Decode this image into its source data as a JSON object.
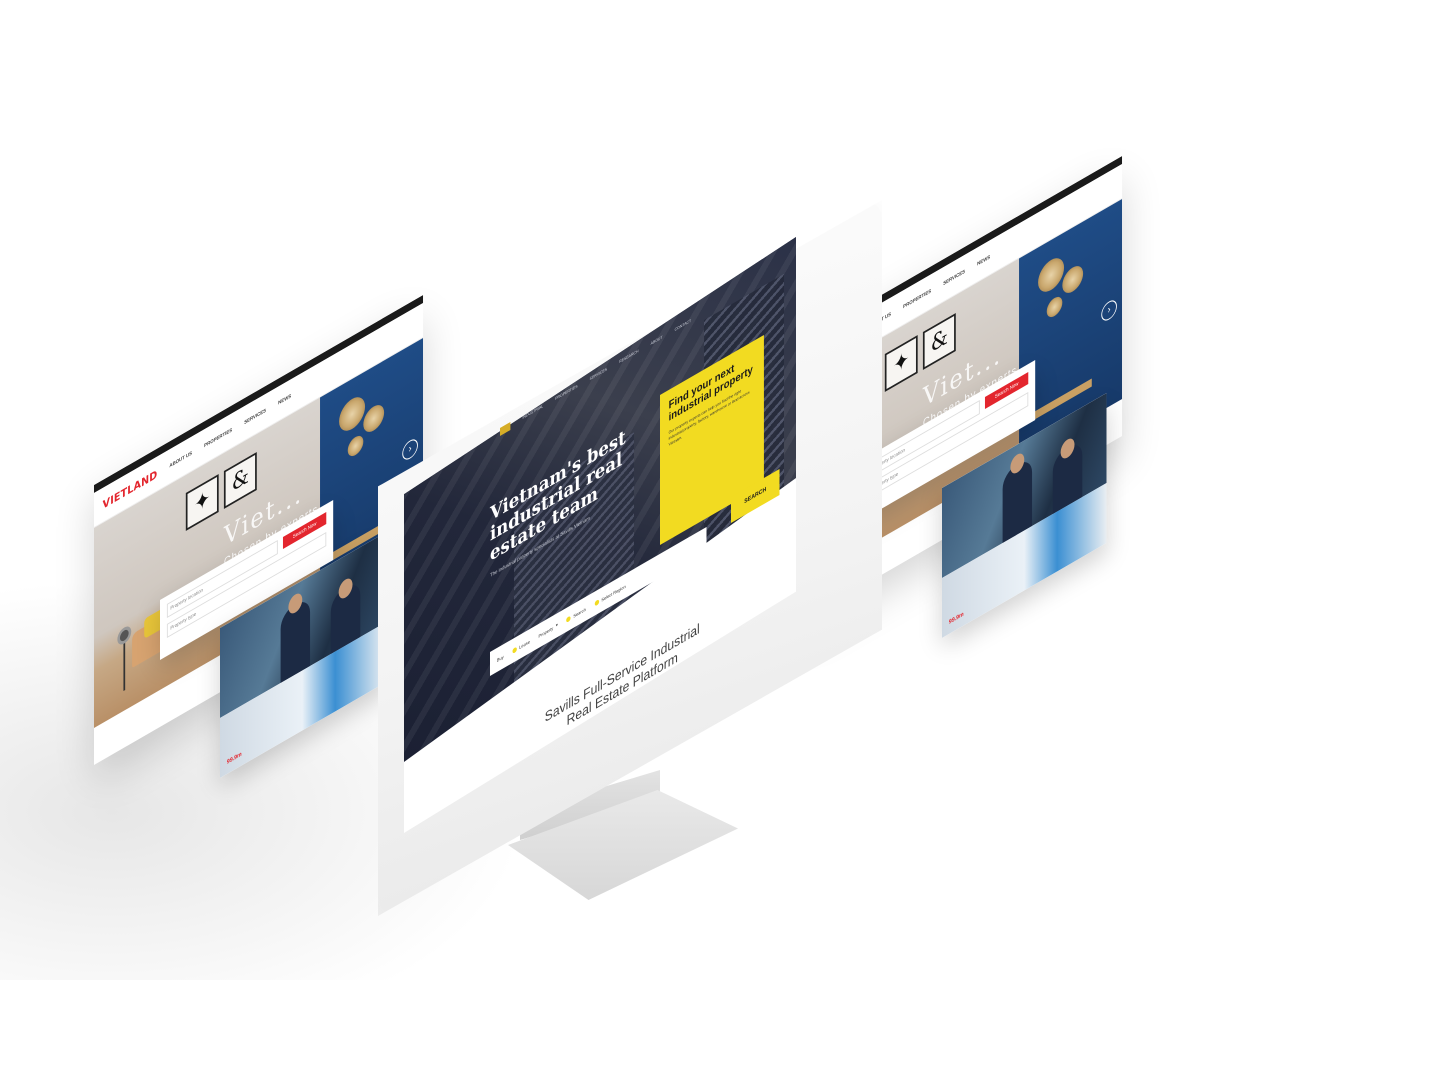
{
  "vietland_site": {
    "logo_main": "VIET",
    "logo_accent": "LAND",
    "nav": [
      "ABOUT US",
      "PROPERTIES",
      "SERVICES",
      "NEWS"
    ],
    "hero_title": "Viet...",
    "hero_subtitle": "Chosen by experts",
    "arrow": "›",
    "frame_glyph": "&",
    "search": {
      "input_1": "Property location",
      "input_2": "Property type",
      "button": "Search Now"
    },
    "card_tag": "99.9m"
  },
  "savills_site": {
    "nav": [
      "INDUSTRIAL",
      "PROPERTIES",
      "SERVICES",
      "RESEARCH",
      "ABOUT",
      "CONTACT"
    ],
    "headline": "Vietnam's best industrial real estate team",
    "subhead": "The industrial property specialists at Savills Vietnam",
    "cta_title": "Find your next industrial property",
    "cta_body": "Our property experts can help you find the right industrial property, factory, warehouse or land across Vietnam.",
    "cta_button": "SEARCH",
    "searchbar": {
      "option_1": "Buy",
      "option_2": "Lease",
      "option_3": "Property",
      "option_4": "Search",
      "option_5": "Select Region"
    },
    "platform_title": "Savills Full-Service Industrial Real Estate Platform"
  },
  "colors": {
    "vietland_red": "#e3262e",
    "vietland_blue": "#1d4fa3",
    "savills_yellow": "#f2db21",
    "savills_navy": "#1d2235"
  }
}
